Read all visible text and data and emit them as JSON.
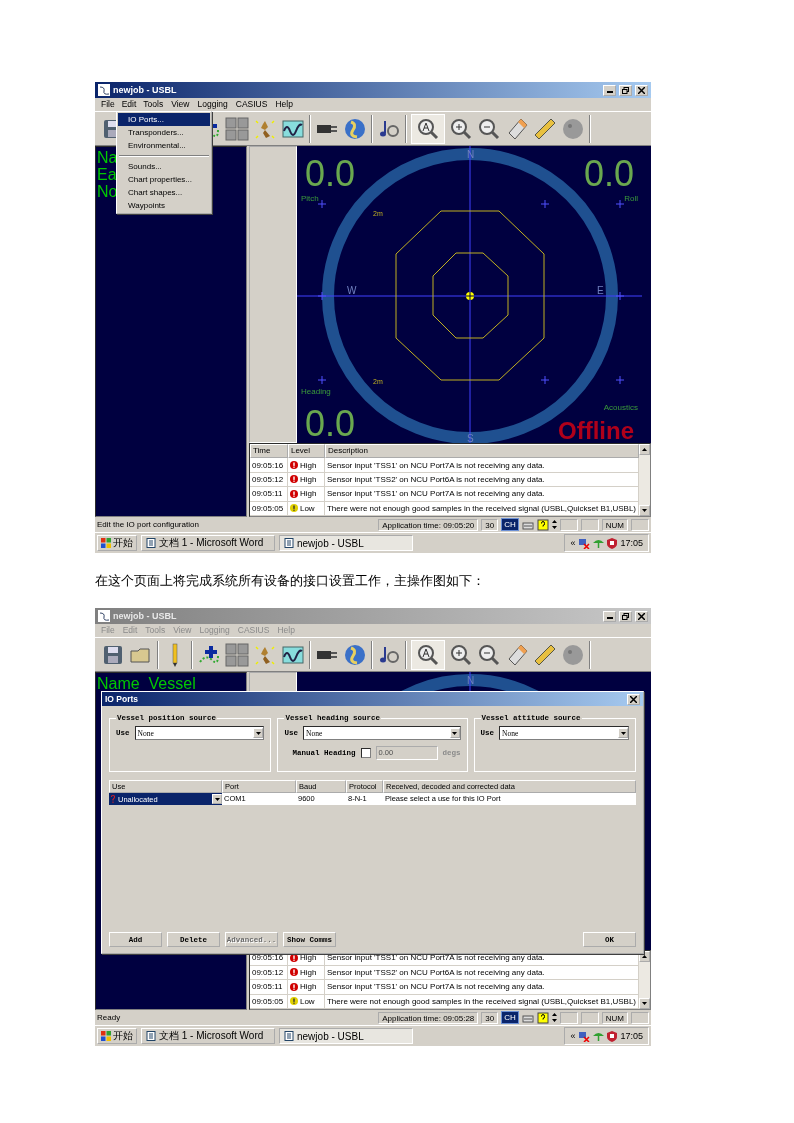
{
  "blocks": [
    {
      "kind": "screenshot",
      "active": true,
      "title": "newjob - USBL",
      "menu": [
        {
          "label": "File",
          "open": false,
          "disabled": false
        },
        {
          "label": "Edit",
          "open": true,
          "disabled": false
        },
        {
          "label": "Tools",
          "open": false,
          "disabled": false
        },
        {
          "label": "View",
          "open": false,
          "disabled": false
        },
        {
          "label": "Logging",
          "open": false,
          "disabled": false
        },
        {
          "label": "CASIUS",
          "open": false,
          "disabled": false
        },
        {
          "label": "Help",
          "open": false,
          "disabled": false
        }
      ],
      "dropdown": [
        {
          "kind": "item",
          "label": "IO Ports...",
          "selected": true
        },
        {
          "kind": "item",
          "label": "Transponders...",
          "selected": false
        },
        {
          "kind": "item",
          "label": "Environmental...",
          "selected": false
        },
        {
          "kind": "separator"
        },
        {
          "kind": "item",
          "label": "Sounds...",
          "selected": false
        },
        {
          "kind": "item",
          "label": "Chart properties...",
          "selected": false
        },
        {
          "kind": "item",
          "label": "Chart shapes...",
          "selected": false
        },
        {
          "kind": "item",
          "label": "Waypoints",
          "selected": false
        }
      ],
      "panel_lines": [
        "Na",
        "Ea",
        "No"
      ],
      "radar": {
        "compass": {
          "top": "N",
          "right": "E",
          "bottom": "S",
          "left": "W"
        },
        "range_labels": [
          "2m",
          "2m"
        ],
        "readouts": {
          "top_left": {
            "value": "0.0",
            "label": "Pitch"
          },
          "top_right": {
            "value": "0.0",
            "label": "Roll"
          },
          "bottom_left": {
            "value": "0.0",
            "label": "Heading"
          },
          "bottom_right": {
            "label": "Acoustics"
          }
        },
        "status": "Offline"
      },
      "log": {
        "columns": [
          "Time",
          "Level",
          "Description"
        ],
        "rows": [
          {
            "time": "09:05:16",
            "kind": "high",
            "level": "High",
            "description": "Sensor input 'TSS1' on NCU Port7A is not receiving any data."
          },
          {
            "time": "09:05:12",
            "kind": "high",
            "level": "High",
            "description": "Sensor input 'TSS2' on NCU Port6A is not receiving any data."
          },
          {
            "time": "09:05:11",
            "kind": "high",
            "level": "High",
            "description": "Sensor input 'TSS1' on NCU Port7A is not receiving any data."
          },
          {
            "time": "09:05:05",
            "kind": "low",
            "level": "Low",
            "description": "There were not enough good samples in the received signal (USBL,Quickset B1,USBL)"
          }
        ]
      },
      "status_bar": {
        "message": "Edit the IO port configuration",
        "app_time": "Application time: 09:05:20",
        "app_count": "30",
        "language": "CH",
        "num": "NUM"
      },
      "taskbar": {
        "start": "开始",
        "tasks": [
          {
            "label": "文档 1 - Microsoft Word",
            "selected": false
          },
          {
            "label": "newjob - USBL",
            "selected": true
          }
        ],
        "tray_chevron": "«",
        "clock": "17:05"
      }
    },
    {
      "kind": "paragraph",
      "text": "在这个页面上将完成系统所有设备的接口设置工作，主操作图如下："
    },
    {
      "kind": "screenshot",
      "active": false,
      "title": "newjob - USBL",
      "menu": [
        {
          "label": "File",
          "open": false,
          "disabled": true
        },
        {
          "label": "Edit",
          "open": false,
          "disabled": true
        },
        {
          "label": "Tools",
          "open": false,
          "disabled": true
        },
        {
          "label": "View",
          "open": false,
          "disabled": true
        },
        {
          "label": "Logging",
          "open": false,
          "disabled": true
        },
        {
          "label": "CASIUS",
          "open": false,
          "disabled": true
        },
        {
          "label": "Help",
          "open": false,
          "disabled": true
        }
      ],
      "panel_lines": [
        "Name  Vessel"
      ],
      "radar": {
        "compass": {
          "top": "N"
        }
      },
      "log": {
        "rows": [
          {
            "time": "09:05:16",
            "kind": "high",
            "level": "High",
            "description": "Sensor input 'TSS1' on NCU Port7A is not receiving any data."
          },
          {
            "time": "09:05:12",
            "kind": "high",
            "level": "High",
            "description": "Sensor input 'TSS2' on NCU Port6A is not receiving any data."
          },
          {
            "time": "09:05:11",
            "kind": "high",
            "level": "High",
            "description": "Sensor input 'TSS1' on NCU Port7A is not receiving any data."
          },
          {
            "time": "09:05:05",
            "kind": "low",
            "level": "Low",
            "description": "There were not enough good samples in the received signal (USBL,Quickset B1,USBL)"
          }
        ]
      },
      "dialog": {
        "title": "IO Ports",
        "sources": [
          {
            "title": "Vessel position source",
            "label": "Use",
            "value": "None"
          },
          {
            "title": "Vessel heading source",
            "label": "Use",
            "value": "None",
            "manual": {
              "label": "Manual Heading",
              "checked": false,
              "value": "0.00",
              "unit": "degs",
              "disabled": true
            }
          },
          {
            "title": "Vessel attitude source",
            "label": "Use",
            "value": "None"
          }
        ],
        "table": {
          "columns": [
            "Use",
            "Port",
            "Baud",
            "Protocol",
            "Received, decoded and corrected data"
          ],
          "rows": [
            {
              "use": "Unallocated",
              "port": "COM1",
              "baud": "9600",
              "protocol": "8-N-1",
              "data": "Please select a use for this IO Port",
              "selected": true
            }
          ]
        },
        "buttons": [
          {
            "label": "Add",
            "disabled": false
          },
          {
            "label": "Delete",
            "disabled": false
          },
          {
            "label": "Advanced...",
            "disabled": true
          },
          {
            "label": "Show Comms",
            "disabled": false
          }
        ],
        "ok": {
          "label": "OK",
          "disabled": false
        }
      },
      "status_bar": {
        "message": "Ready",
        "app_time": "Application time: 09:05:28",
        "app_count": "30",
        "language": "CH",
        "num": "NUM"
      },
      "taskbar": {
        "start": "开始",
        "tasks": [
          {
            "label": "文档 1 - Microsoft Word",
            "selected": false
          },
          {
            "label": "newjob - USBL",
            "selected": true
          }
        ],
        "tray_chevron": "«",
        "clock": "17:05"
      }
    }
  ]
}
